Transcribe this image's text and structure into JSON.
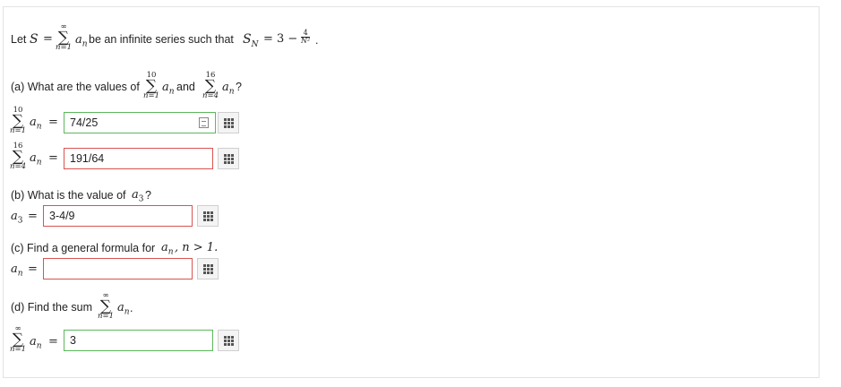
{
  "intro": {
    "let": "Let ",
    "S": "S",
    "eq": "=",
    "sum_top": "∞",
    "sum_bot": "n=1",
    "an": "a",
    "an_sub": "n",
    "mid": " be an infinite series such that ",
    "SN": "S",
    "SN_sub": "N",
    "eq2": "= 3 −",
    "frac_num": "4",
    "frac_den": "N²",
    "end": "."
  },
  "part_a": {
    "prompt_label": "(a)",
    "prompt_text": " What are the values of ",
    "sum1_top": "10",
    "sum1_bot": "n=1",
    "and": " and ",
    "sum2_top": "16",
    "sum2_bot": "n=4",
    "q": "?",
    "row1": {
      "top": "10",
      "bot": "n=1",
      "eq": "=",
      "value": "74/25"
    },
    "row2": {
      "top": "16",
      "bot": "n=4",
      "eq": "=",
      "value": "191/64"
    }
  },
  "part_b": {
    "prompt_label": "(b)",
    "prompt_text": " What is the value of ",
    "var": "a",
    "var_sub": "3",
    "q": "?",
    "eq": "=",
    "value": "3-4/9"
  },
  "part_c": {
    "prompt_label": "(c)",
    "prompt_text": " Find a general formula for ",
    "var": "a",
    "var_sub": "n",
    "cond": ", n > 1.",
    "eq": "=",
    "value": ""
  },
  "part_d": {
    "prompt_label": "(d)",
    "prompt_text": " Find the sum ",
    "sum_top": "∞",
    "sum_bot": "n=1",
    "end": ".",
    "row": {
      "top": "∞",
      "bot": "n=1",
      "eq": "=",
      "value": "3"
    }
  },
  "common": {
    "sigma": "∑",
    "a": "a",
    "n": "n"
  },
  "colors": {
    "correct": "#5cb85c",
    "incorrect": "#d9534f"
  },
  "icons": {
    "matrix": "grid-matrix-icon",
    "preview": "preview-icon"
  }
}
